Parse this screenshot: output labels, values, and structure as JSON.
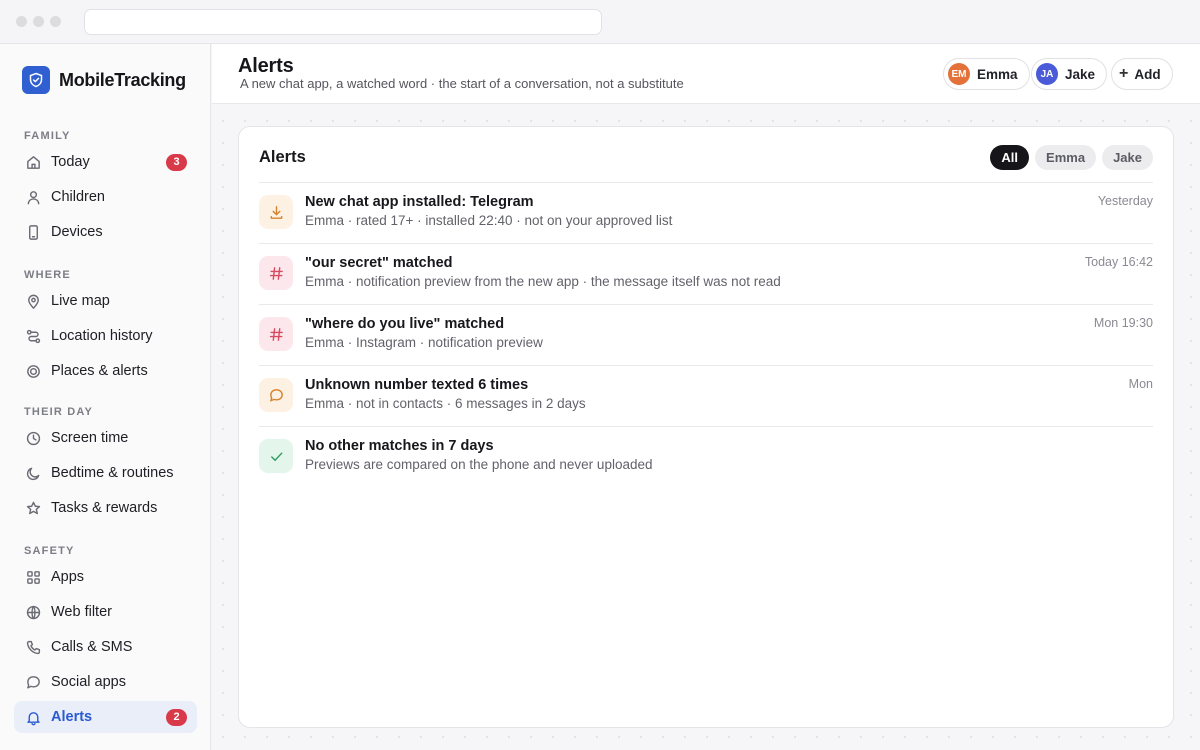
{
  "brand": {
    "name": "MobileTracking",
    "accent": "#2f5fd0"
  },
  "sidebar": {
    "sections": [
      {
        "title": "FAMILY",
        "items": [
          {
            "label": "Today",
            "icon": "home-icon",
            "badge": "3"
          },
          {
            "label": "Children",
            "icon": "person-icon"
          },
          {
            "label": "Devices",
            "icon": "phone-icon"
          }
        ]
      },
      {
        "title": "WHERE",
        "items": [
          {
            "label": "Live map",
            "icon": "map-pin-icon"
          },
          {
            "label": "Location history",
            "icon": "route-icon"
          },
          {
            "label": "Places & alerts",
            "icon": "target-icon"
          }
        ]
      },
      {
        "title": "THEIR DAY",
        "items": [
          {
            "label": "Screen time",
            "icon": "clock-icon"
          },
          {
            "label": "Bedtime & routines",
            "icon": "moon-icon"
          },
          {
            "label": "Tasks & rewards",
            "icon": "star-icon"
          }
        ]
      },
      {
        "title": "SAFETY",
        "items": [
          {
            "label": "Apps",
            "icon": "grid-icon"
          },
          {
            "label": "Web filter",
            "icon": "globe-icon"
          },
          {
            "label": "Calls & SMS",
            "icon": "phone-call-icon"
          },
          {
            "label": "Social apps",
            "icon": "chat-bubble-icon"
          },
          {
            "label": "Alerts",
            "icon": "bell-icon",
            "badge": "2",
            "active": true
          }
        ]
      }
    ]
  },
  "header": {
    "title": "Alerts",
    "subtitle": "A new chat app, a watched word · the start of a conversation, not a substitute",
    "children": [
      {
        "initials": "EM",
        "name": "Emma",
        "color": "#e4713a"
      },
      {
        "initials": "JA",
        "name": "Jake",
        "color": "#4a5ad8"
      }
    ],
    "add_label": "Add"
  },
  "card": {
    "title": "Alerts",
    "filters": [
      {
        "label": "All",
        "active": true
      },
      {
        "label": "Emma"
      },
      {
        "label": "Jake"
      }
    ],
    "alerts": [
      {
        "icon": "download-icon",
        "title": "New chat app installed: Telegram",
        "detail": "Emma · rated 17+ · installed 22:40 · not on your approved list",
        "time": "Yesterday"
      },
      {
        "icon": "hash-icon",
        "title": "\"our secret\" matched",
        "detail": "Emma · notification preview from the new app · the message itself was not read",
        "time": "Today 16:42"
      },
      {
        "icon": "hash-icon",
        "title": "\"where do you live\" matched",
        "detail": "Emma · Instagram · notification preview",
        "time": "Mon 19:30"
      },
      {
        "icon": "chat-bubble-icon",
        "title": "Unknown number texted 6 times",
        "detail": "Emma · not in contacts · 6 messages in 2 days",
        "time": "Mon"
      },
      {
        "icon": "check-icon",
        "title": "No other matches in 7 days",
        "detail": "Previews are compared on the phone and never uploaded",
        "time": ""
      }
    ]
  }
}
